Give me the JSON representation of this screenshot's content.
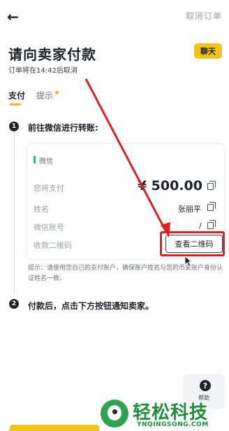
{
  "header": {
    "back_icon": "←",
    "cancel_label": "取消订单"
  },
  "title": "请向卖家付款",
  "chat_label": "聊天",
  "deadline_text": "订单将在14:42后取消",
  "tabs": [
    {
      "label": "支付"
    },
    {
      "label": "提示"
    }
  ],
  "steps": [
    {
      "num": "1",
      "text": "前往微信进行转账:"
    },
    {
      "num": "2",
      "text": "付款后，点击下方按钮通知卖家。"
    }
  ],
  "payment": {
    "method": "微信",
    "amount_label": "您将支付",
    "amount_value": "¥ 500.00",
    "name_label": "姓名",
    "name_value": "张丽平",
    "account_label": "微信账号",
    "account_value": "/",
    "qr_label": "收款二维码",
    "qr_button": "查看二维码"
  },
  "tip_text": "提示：请使用您自己的支付账户，确保账户姓名与您的币安账户身份认证姓名一致。",
  "help": {
    "icon": "?",
    "label": "帮助"
  },
  "watermark": {
    "title": "轻松科技",
    "subtitle": "YNQINGSONG.COM"
  },
  "colors": {
    "accent": "#f0b90b",
    "highlight": "#e02020",
    "wechat": "#2ebd85"
  }
}
